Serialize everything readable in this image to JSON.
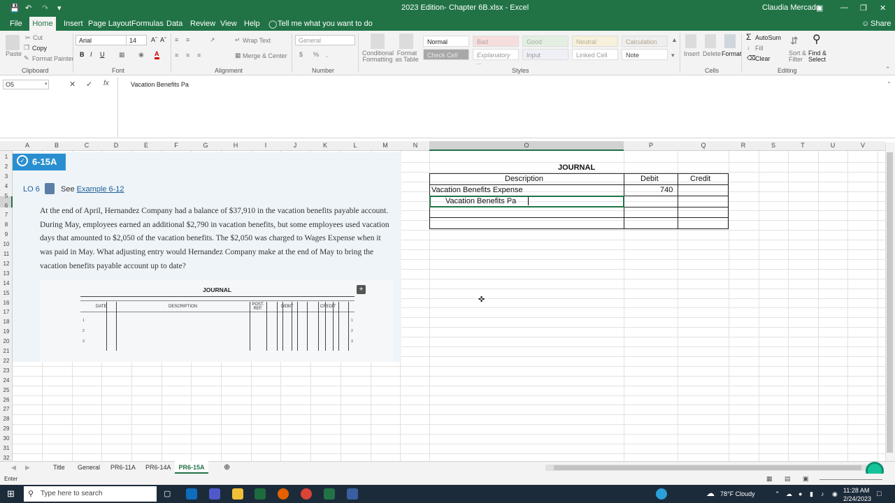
{
  "title_bar": {
    "doc_title": "2023 Edition- Chapter 6B.xlsx - Excel",
    "user": "Claudia Mercado"
  },
  "menu": {
    "tabs": [
      "File",
      "Home",
      "Insert",
      "Page Layout",
      "Formulas",
      "Data",
      "Review",
      "View",
      "Help"
    ],
    "tell_me": "Tell me what you want to do",
    "share": "Share"
  },
  "ribbon": {
    "clipboard": {
      "paste": "Paste",
      "cut": "Cut",
      "copy": "Copy",
      "format_painter": "Format Painter",
      "label": "Clipboard"
    },
    "font": {
      "family": "Arial",
      "size": "14",
      "label": "Font"
    },
    "alignment": {
      "wrap_text": "Wrap Text",
      "merge": "Merge & Center",
      "label": "Alignment"
    },
    "number": {
      "format": "General",
      "label": "Number"
    },
    "styles": {
      "conditional": "Conditional Formatting",
      "format_table": "Format as Table",
      "normal": "Normal",
      "bad": "Bad",
      "good": "Good",
      "neutral": "Neutral",
      "calculation": "Calculation",
      "check_cell": "Check Cell",
      "explanatory": "Explanatory ...",
      "input": "Input",
      "linked_cell": "Linked Cell",
      "note": "Note",
      "label": "Styles"
    },
    "cells": {
      "insert": "Insert",
      "delete": "Delete",
      "format": "Format",
      "label": "Cells"
    },
    "editing": {
      "autosum": "AutoSum",
      "fill": "Fill",
      "clear": "Clear",
      "sort": "Sort & Filter",
      "find": "Find & Select",
      "label": "Editing"
    }
  },
  "formula_bar": {
    "name_box": "O5",
    "content": "Vacation Benefits Pa"
  },
  "columns": [
    "A",
    "B",
    "C",
    "D",
    "E",
    "F",
    "G",
    "H",
    "I",
    "J",
    "K",
    "L",
    "M",
    "N",
    "O",
    "P",
    "Q",
    "R",
    "S",
    "T",
    "U",
    "V"
  ],
  "rows": [
    "1",
    "2",
    "3",
    "4",
    "5",
    "6",
    "7",
    "8",
    "9",
    "10",
    "11",
    "12",
    "13",
    "14",
    "15",
    "16",
    "17",
    "18",
    "19",
    "20",
    "21",
    "22",
    "23",
    "24",
    "25",
    "26",
    "27",
    "28",
    "29",
    "30",
    "31",
    "32"
  ],
  "textbook": {
    "badge": "6-15A",
    "lo": "LO 6",
    "see": "See",
    "example_link": "Example 6-12",
    "problem": "At the end of April, Hernandez Company had a balance of $37,910 in the vacation benefits payable account. During May, employees earned an additional $2,790 in vacation benefits, but some employees used vacation days that amounted to $2,050 of the vacation benefits. The $2,050 was charged to Wages Expense when it was paid in May. What adjusting entry would Hernandez Company make at the end of May to bring the vacation benefits payable account up to date?",
    "journal_title": "JOURNAL",
    "headers": {
      "date": "DATE",
      "description": "DESCRIPTION",
      "post_ref": "POST. REF.",
      "debit": "DEBIT",
      "credit": "CREDIT"
    },
    "line_numbers": [
      "1",
      "2",
      "3"
    ]
  },
  "journal": {
    "title": "JOURNAL",
    "header_description": "Description",
    "header_debit": "Debit",
    "header_credit": "Credit",
    "row1_description": "Vacation Benefits Expense",
    "row1_debit": "740",
    "row2_description": "Vacation Benefits Pa"
  },
  "sheet_tabs": [
    "Title",
    "General",
    "PR6-11A",
    "PR6-14A"
  ],
  "active_sheet": "PR6-15A",
  "status": {
    "mode": "Enter"
  },
  "taskbar": {
    "search_placeholder": "Type here to search",
    "weather": "78°F  Cloudy",
    "time": "11:28 AM",
    "date": "2/24/2023"
  }
}
